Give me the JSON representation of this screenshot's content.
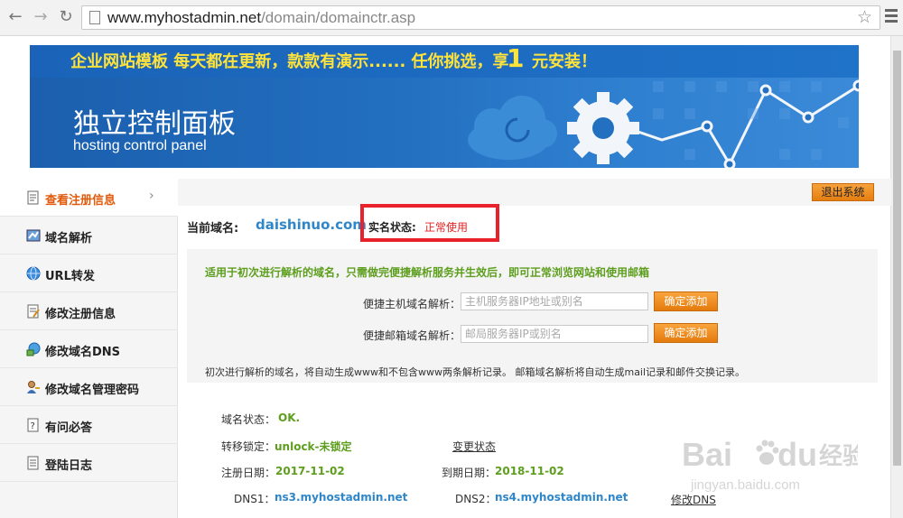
{
  "browser": {
    "url_host": "www.myhostadmin.net",
    "url_path": "/domain/domainctr.asp"
  },
  "banner": {
    "promo_text": "企业网站模板 每天都在更新，款款有演示...... 任你挑选，享",
    "promo_number": "1",
    "promo_tail": "元安装！",
    "title": "独立控制面板",
    "subtitle": "hosting control panel",
    "colors": {
      "background": "#236fc0",
      "promo_text": "#ffe33a"
    }
  },
  "sidebar": {
    "items": [
      {
        "label": "查看注册信息",
        "icon": "document-icon",
        "active": true
      },
      {
        "label": "域名解析",
        "icon": "dns-resolve-icon",
        "active": false
      },
      {
        "label": "URL转发",
        "icon": "globe-icon",
        "active": false
      },
      {
        "label": "修改注册信息",
        "icon": "edit-document-icon",
        "active": false
      },
      {
        "label": "修改域名DNS",
        "icon": "network-globe-icon",
        "active": false
      },
      {
        "label": "修改域名管理密码",
        "icon": "user-key-icon",
        "active": false
      },
      {
        "label": "有问必答",
        "icon": "chat-icon",
        "active": false
      },
      {
        "label": "登陆日志",
        "icon": "log-icon",
        "active": false
      }
    ]
  },
  "toolbar": {
    "logout_label": "退出系统"
  },
  "domain": {
    "current_label": "当前域名:",
    "current_value": "daishinuo.com",
    "realname_label": "实名状态:",
    "realname_value": "正常使用"
  },
  "quick_panel": {
    "title": "适用于初次进行解析的域名，只需做完便捷解析服务并生效后，即可正常浏览网站和使用邮箱",
    "host_label": "便捷主机域名解析：",
    "host_placeholder": "主机服务器IP地址或别名",
    "mail_label": "便捷邮箱域名解析：",
    "mail_placeholder": "邮局服务器IP或别名",
    "add_label": "确定添加",
    "note": "初次进行解析的域名，将自动生成www和不包含www两条解析记录。 邮箱域名解析将自动生成mail记录和邮件交换记录。"
  },
  "info": {
    "status_label": "域名状态：",
    "status_value": "OK.",
    "transfer_label": "转移锁定：",
    "transfer_value": "unlock-未锁定",
    "change_status": "变更状态",
    "reg_label": "注册日期：",
    "reg_value": "2017-11-02",
    "exp_label": "到期日期：",
    "exp_value": "2018-11-02",
    "dns1_label": "DNS1：",
    "dns1_value": "ns3.myhostadmin.net",
    "dns2_label": "DNS2：",
    "dns2_value": "ns4.myhostadmin.net",
    "modify_dns": "修改DNS"
  },
  "watermark": {
    "brand": "Bai",
    "brand2": "du",
    "cn": "经验",
    "url": "jingyan.baidu.com"
  }
}
